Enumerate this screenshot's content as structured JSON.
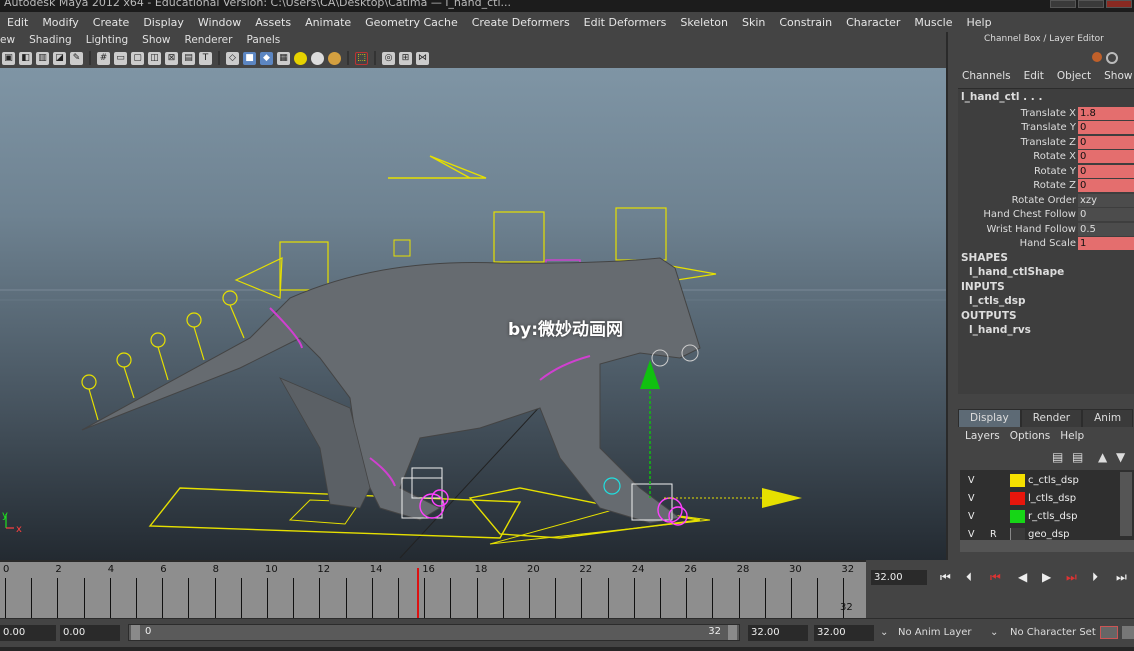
{
  "window": {
    "title": "Autodesk Maya 2012 x64 - Educational Version: C:\\Users\\CA\\Desktop\\Catima — l_hand_ctl..."
  },
  "main_menu": [
    "Edit",
    "Modify",
    "Create",
    "Display",
    "Window",
    "Assets",
    "Animate",
    "Geometry Cache",
    "Create Deformers",
    "Edit Deformers",
    "Skeleton",
    "Skin",
    "Constrain",
    "Character",
    "Muscle",
    "Help"
  ],
  "panel_menu": [
    "ew",
    "Shading",
    "Lighting",
    "Show",
    "Renderer",
    "Panels"
  ],
  "viewport": {
    "watermark": "by:微妙动画网",
    "axis_y": "y",
    "axis_x": "x"
  },
  "channel_box": {
    "title": "Channel Box / Layer Editor",
    "menu": [
      "Channels",
      "Edit",
      "Object",
      "Show"
    ],
    "object_name": "l_hand_ctl . . .",
    "attributes": [
      {
        "name": "Translate X",
        "value": "1.8"
      },
      {
        "name": "Translate Y",
        "value": "0"
      },
      {
        "name": "Translate Z",
        "value": "0"
      },
      {
        "name": "Rotate X",
        "value": "0"
      },
      {
        "name": "Rotate Y",
        "value": "0"
      },
      {
        "name": "Rotate Z",
        "value": "0"
      },
      {
        "name": "Rotate Order",
        "value": "xzy"
      },
      {
        "name": "Hand Chest Follow",
        "value": "0"
      },
      {
        "name": "Wrist Hand Follow",
        "value": "0.5"
      },
      {
        "name": "Hand Scale",
        "value": "1"
      }
    ],
    "shapes_header": "SHAPES",
    "shape_name": "l_hand_ctlShape",
    "inputs_header": "INPUTS",
    "input_name": "l_ctls_dsp",
    "outputs_header": "OUTPUTS",
    "output_name": "l_hand_rvs"
  },
  "layer_editor": {
    "tabs": [
      "Display",
      "Render",
      "Anim"
    ],
    "menu": [
      "Layers",
      "Options",
      "Help"
    ],
    "layers": [
      {
        "v": "V",
        "p": "",
        "color": "#f5e000",
        "name": "c_ctls_dsp"
      },
      {
        "v": "V",
        "p": "",
        "color": "#e8160c",
        "name": "l_ctls_dsp"
      },
      {
        "v": "V",
        "p": "",
        "color": "#16d616",
        "name": "r_ctls_dsp"
      },
      {
        "v": "V",
        "p": "R",
        "color": "#3a3a3a",
        "name": "geo_dsp"
      }
    ]
  },
  "timeline": {
    "labels": [
      "0",
      "2",
      "4",
      "6",
      "8",
      "10",
      "12",
      "14",
      "16",
      "18",
      "20",
      "22",
      "24",
      "26",
      "28",
      "30",
      "32"
    ],
    "current_frame": "32.00",
    "end_label": "32"
  },
  "range": {
    "start": "0.00",
    "anim_start": "0.00",
    "slider_start": "0",
    "slider_end": "32",
    "playback_end": "32.00",
    "anim_end": "32.00",
    "anim_layer": "No Anim Layer",
    "character_set": "No Character Set"
  }
}
